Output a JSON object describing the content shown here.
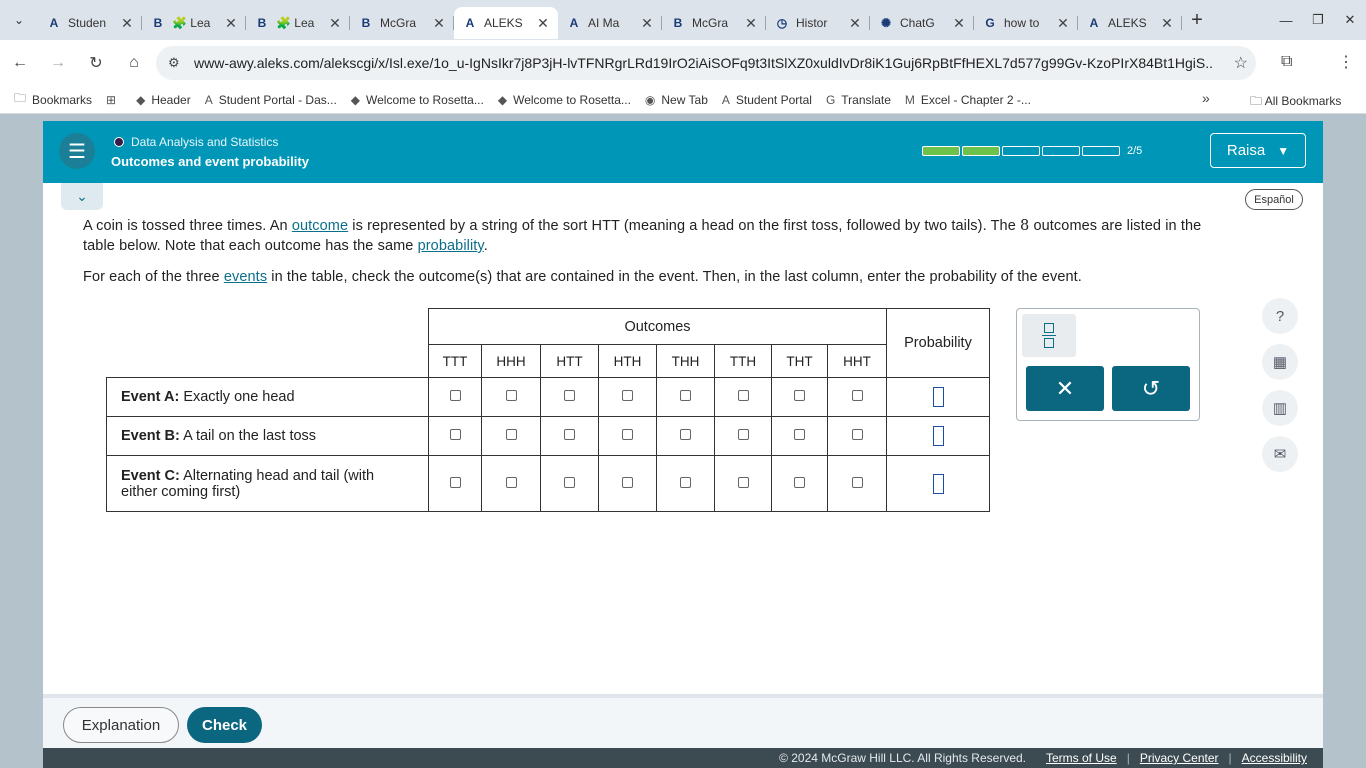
{
  "browser": {
    "tabs": [
      {
        "icon": "aleks-a",
        "title": "Studen"
      },
      {
        "icon": "bt",
        "title": "🧩 Lea"
      },
      {
        "icon": "bt",
        "title": "🧩 Lea"
      },
      {
        "icon": "bt",
        "title": "McGra"
      },
      {
        "icon": "aleks-a",
        "title": "ALEKS",
        "active": true
      },
      {
        "icon": "aleks-a",
        "title": "AI Ma"
      },
      {
        "icon": "bt",
        "title": "McGra"
      },
      {
        "icon": "history",
        "title": "Histor"
      },
      {
        "icon": "chatgpt",
        "title": "ChatG"
      },
      {
        "icon": "google",
        "title": "how to"
      },
      {
        "icon": "aleks-a",
        "title": "ALEKS"
      }
    ],
    "url": "www-awy.aleks.com/alekscgi/x/Isl.exe/1o_u-IgNsIkr7j8P3jH-lvTFNRgrLRd19IrO2iAiSOFq9t3ItSlXZ0xuldIvDr8iK1Guj6RpBtFfHEXL7d577g99Gv-KzoPIrX84Bt1HgiS...",
    "bookmarks": [
      {
        "icon": "folder",
        "label": "Bookmarks"
      },
      {
        "icon": "apps",
        "label": ""
      },
      {
        "icon": "blue-drop",
        "label": "Header"
      },
      {
        "icon": "aleks-a",
        "label": "Student Portal - Das..."
      },
      {
        "icon": "blue-drop",
        "label": "Welcome to Rosetta..."
      },
      {
        "icon": "blue-drop",
        "label": "Welcome to Rosetta..."
      },
      {
        "icon": "globe",
        "label": "New Tab"
      },
      {
        "icon": "aleks-a",
        "label": "Student Portal"
      },
      {
        "icon": "translate",
        "label": "Translate"
      },
      {
        "icon": "mcgraw-m",
        "label": "Excel - Chapter 2 -..."
      }
    ],
    "all_bookmarks": "All Bookmarks"
  },
  "header": {
    "topic": "Data Analysis and Statistics",
    "lesson": "Outcomes and event probability",
    "progress": {
      "current": 2,
      "total": 5,
      "label": "2/5"
    },
    "user": "Raisa",
    "accent": "#0096b7"
  },
  "language_button": "Español",
  "problem": {
    "p1_a": "A coin is tossed three times. An ",
    "p1_link1": "outcome",
    "p1_b": " is represented by a string of the sort HTT (meaning a head on the first toss, followed by two tails). The ",
    "p1_num": "8",
    "p1_c": " outcomes are listed in the table below. Note that each outcome has the same ",
    "p1_link2": "probability",
    "p1_d": ".",
    "p2_a": "For each of the three ",
    "p2_link": "events",
    "p2_b": " in the table, check the outcome(s) that are contained in the event. Then, in the last column, enter the probability of the event."
  },
  "table": {
    "outcomes_header": "Outcomes",
    "probability_header": "Probability",
    "columns": [
      "TTT",
      "HHH",
      "HTT",
      "HTH",
      "THH",
      "TTH",
      "THT",
      "HHT"
    ],
    "events": [
      {
        "label": "Event A:",
        "desc": "Exactly one head"
      },
      {
        "label": "Event B:",
        "desc": "A tail on the last toss"
      },
      {
        "label": "Event C:",
        "desc": "Alternating head and tail (with either coming first)"
      }
    ]
  },
  "keypad": {
    "fraction_icon": "fraction-icon",
    "clear_icon": "close-icon",
    "undo_icon": "undo-icon"
  },
  "tools": [
    "help-icon",
    "calculator-icon",
    "book-icon",
    "mail-icon"
  ],
  "buttons": {
    "explanation": "Explanation",
    "check": "Check"
  },
  "footer": {
    "copyright": "© 2024 McGraw Hill LLC. All Rights Reserved.",
    "terms": "Terms of Use",
    "privacy": "Privacy Center",
    "accessibility": "Accessibility"
  }
}
